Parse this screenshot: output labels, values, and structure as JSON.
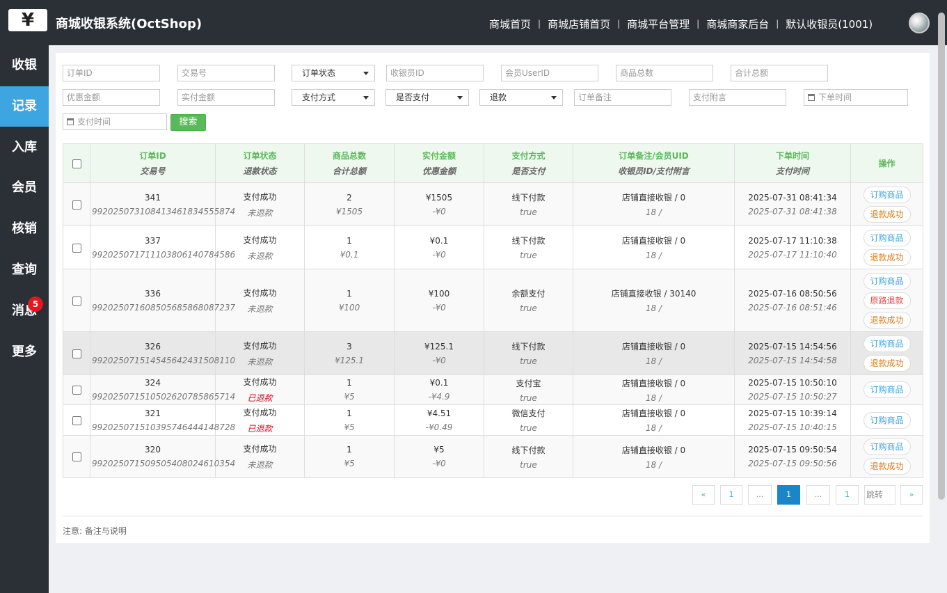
{
  "header": {
    "logo_glyph": "¥",
    "title": "商城收银系统(OctShop)",
    "nav": [
      "商城首页",
      "商城店铺首页",
      "商城平台管理",
      "商城商家后台",
      "默认收银员(1001)"
    ]
  },
  "sidebar": {
    "items": [
      {
        "label": "收银"
      },
      {
        "label": "记录",
        "active": true
      },
      {
        "label": "入库"
      },
      {
        "label": "会员"
      },
      {
        "label": "核销"
      },
      {
        "label": "查询"
      },
      {
        "label": "消息",
        "badge": "5"
      },
      {
        "label": "更多"
      }
    ]
  },
  "filters": {
    "order_id": "订单ID",
    "trade_no": "交易号",
    "order_status": "订单状态",
    "cashier_id": "收银员ID",
    "member_uid": "会员UserID",
    "goods_total": "商品总数",
    "sum_total": "合计总额",
    "discount": "优惠金额",
    "paid_amount": "实付金额",
    "pay_method": "支付方式",
    "is_paid": "是否支付",
    "refund": "退款",
    "order_memo": "订单备注",
    "pay_attach": "支付附言",
    "order_time": "下单时间",
    "pay_time": "支付时间",
    "search_button": "搜索"
  },
  "table": {
    "headers": [
      {
        "main": "订单ID",
        "sub": "交易号"
      },
      {
        "main": "订单状态",
        "sub": "退款状态"
      },
      {
        "main": "商品总数",
        "sub": "合计总额"
      },
      {
        "main": "实付金额",
        "sub": "优惠金额"
      },
      {
        "main": "支付方式",
        "sub": "是否支付"
      },
      {
        "main": "订单备注/会员UID",
        "sub": "收银员ID/支付附言"
      },
      {
        "main": "下单时间",
        "sub": "支付时间"
      },
      {
        "main": "操作",
        "sub": ""
      }
    ],
    "rows": [
      {
        "id": "341",
        "trade": "992025073108413461834555874",
        "status": "支付成功",
        "refund": "未退款",
        "count": "2",
        "total": "¥1505",
        "paid": "¥1505",
        "discount": "-¥0",
        "method": "线下付款",
        "is_paid": "true",
        "memo": "店铺直接收银 / 0",
        "cashier": "18 /",
        "order_time": "2025-07-31 08:41:34",
        "pay_time": "2025-07-31 08:41:38",
        "ops": [
          {
            "label": "订购商品",
            "color": "blue"
          },
          {
            "label": "退款成功",
            "color": "orange"
          }
        ]
      },
      {
        "id": "337",
        "trade": "992025071711103806140784586",
        "status": "支付成功",
        "refund": "未退款",
        "count": "1",
        "total": "¥0.1",
        "paid": "¥0.1",
        "discount": "-¥0",
        "method": "线下付款",
        "is_paid": "true",
        "memo": "店铺直接收银 / 0",
        "cashier": "18 /",
        "order_time": "2025-07-17 11:10:38",
        "pay_time": "2025-07-17 11:10:40",
        "ops": [
          {
            "label": "订购商品",
            "color": "blue"
          },
          {
            "label": "退款成功",
            "color": "orange"
          }
        ]
      },
      {
        "id": "336",
        "trade": "992025071608505685868087237",
        "status": "支付成功",
        "refund": "未退款",
        "count": "1",
        "total": "¥100",
        "paid": "¥100",
        "discount": "-¥0",
        "method": "余额支付",
        "is_paid": "true",
        "memo": "店铺直接收银 / 30140",
        "cashier": "18 /",
        "order_time": "2025-07-16 08:50:56",
        "pay_time": "2025-07-16 08:51:46",
        "ops": [
          {
            "label": "订购商品",
            "color": "blue"
          },
          {
            "label": "原路退款",
            "color": "red"
          },
          {
            "label": "退款成功",
            "color": "orange"
          }
        ]
      },
      {
        "id": "326",
        "trade": "992025071514545642431508110",
        "status": "支付成功",
        "refund": "未退款",
        "count": "3",
        "total": "¥125.1",
        "paid": "¥125.1",
        "discount": "-¥0",
        "method": "线下付款",
        "is_paid": "true",
        "memo": "店铺直接收银 / 0",
        "cashier": "18 /",
        "order_time": "2025-07-15 14:54:56",
        "pay_time": "2025-07-15 14:54:58",
        "ops": [
          {
            "label": "订购商品",
            "color": "blue"
          },
          {
            "label": "退款成功",
            "color": "orange"
          }
        ]
      },
      {
        "id": "324",
        "trade": "992025071510502620785865714",
        "status": "支付成功",
        "refund": "已退款",
        "refund_red": true,
        "count": "1",
        "total": "¥5",
        "paid": "¥0.1",
        "discount": "-¥4.9",
        "method": "支付宝",
        "is_paid": "true",
        "memo": "店铺直接收银 / 0",
        "cashier": "18 /",
        "order_time": "2025-07-15 10:50:10",
        "pay_time": "2025-07-15 10:50:27",
        "ops": [
          {
            "label": "订购商品",
            "color": "blue"
          }
        ]
      },
      {
        "id": "321",
        "trade": "992025071510395746444148728",
        "status": "支付成功",
        "refund": "已退款",
        "refund_red": true,
        "count": "1",
        "total": "¥5",
        "paid": "¥4.51",
        "discount": "-¥0.49",
        "method": "微信支付",
        "is_paid": "true",
        "memo": "店铺直接收银 / 0",
        "cashier": "18 /",
        "order_time": "2025-07-15 10:39:14",
        "pay_time": "2025-07-15 10:40:15",
        "ops": [
          {
            "label": "订购商品",
            "color": "blue"
          }
        ]
      },
      {
        "id": "320",
        "trade": "992025071509505408024610354",
        "status": "支付成功",
        "refund": "未退款",
        "count": "1",
        "total": "¥5",
        "paid": "¥5",
        "discount": "-¥0",
        "method": "线下付款",
        "is_paid": "true",
        "memo": "店铺直接收银 / 0",
        "cashier": "18 /",
        "order_time": "2025-07-15 09:50:54",
        "pay_time": "2025-07-15 09:50:56",
        "ops": [
          {
            "label": "订购商品",
            "color": "blue"
          },
          {
            "label": "退款成功",
            "color": "orange"
          }
        ]
      }
    ]
  },
  "pagination": {
    "prev": "«",
    "first": "1",
    "ellipsis1": "...",
    "current": "1",
    "ellipsis2": "...",
    "last": "1",
    "jump_placeholder": "跳转",
    "next": "»"
  },
  "footer_note": "注意: 备注与说明"
}
